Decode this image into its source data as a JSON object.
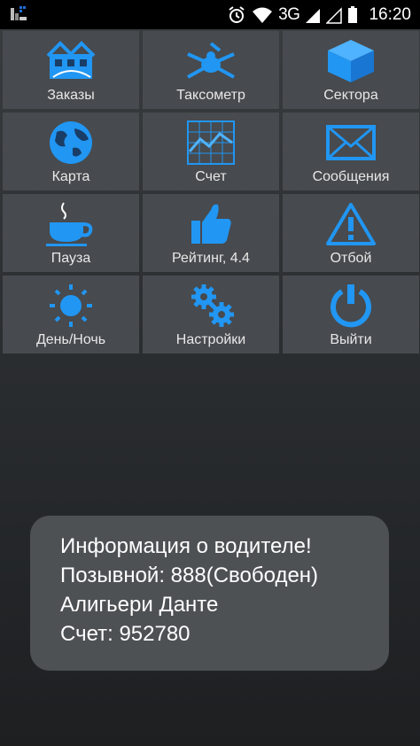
{
  "status_bar": {
    "network": "3G",
    "time": "16:20",
    "icons": [
      "app-notification-icon",
      "alarm-icon",
      "wifi-icon",
      "signal-icon",
      "signal-icon",
      "battery-icon"
    ]
  },
  "menu": {
    "accent_color": "#2196f3",
    "tiles": [
      {
        "label": "Заказы",
        "icon": "orders-icon"
      },
      {
        "label": "Таксометр",
        "icon": "taximeter-icon"
      },
      {
        "label": "Сектора",
        "icon": "sectors-icon"
      },
      {
        "label": "Карта",
        "icon": "globe-icon"
      },
      {
        "label": "Счет",
        "icon": "chart-icon"
      },
      {
        "label": "Сообщения",
        "icon": "envelope-icon"
      },
      {
        "label": "Пауза",
        "icon": "coffee-cup-icon"
      },
      {
        "label": "Рейтинг, 4.4",
        "icon": "thumbs-up-icon"
      },
      {
        "label": "Отбой",
        "icon": "warning-icon"
      },
      {
        "label": "День/Ночь",
        "icon": "sun-icon"
      },
      {
        "label": "Настройки",
        "icon": "gears-icon"
      },
      {
        "label": "Выйти",
        "icon": "power-icon"
      }
    ]
  },
  "toast": {
    "line1": "Информация о водителе!",
    "line2": "Позывной: 888(Свободен)",
    "line3": "Алигьери Данте",
    "line4": "Счет: 952780"
  }
}
